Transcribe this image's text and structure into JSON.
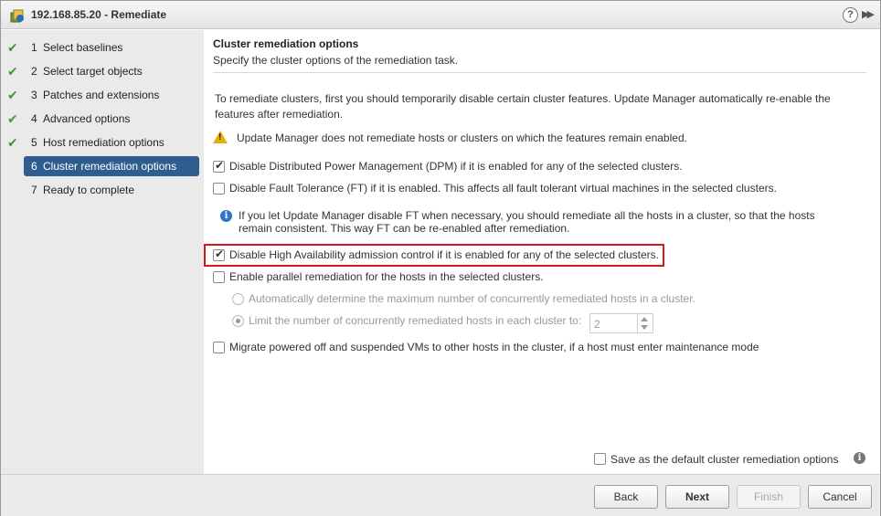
{
  "window": {
    "title": "192.168.85.20 - Remediate",
    "help_label": "?",
    "expand_label": "▶▶"
  },
  "steps": [
    {
      "num": "1",
      "label": "Select baselines",
      "done": true
    },
    {
      "num": "2",
      "label": "Select target objects",
      "done": true
    },
    {
      "num": "3",
      "label": "Patches and extensions",
      "done": true
    },
    {
      "num": "4",
      "label": "Advanced options",
      "done": true
    },
    {
      "num": "5",
      "label": "Host remediation options",
      "done": true
    },
    {
      "num": "6",
      "label": "Cluster remediation options",
      "done": false,
      "active": true
    },
    {
      "num": "7",
      "label": "Ready to complete",
      "done": false
    }
  ],
  "check_glyph": "✔",
  "header": {
    "title": "Cluster remediation options",
    "subtitle": "Specify the cluster options of the remediation task."
  },
  "intro": {
    "line1": "To remediate clusters, first you should temporarily disable certain cluster features. Update Manager automatically re-enable the",
    "line2": "features after remediation."
  },
  "warning": "Update Manager does not remediate hosts or clusters on which the features remain enabled.",
  "options": {
    "dpm": {
      "label": "Disable Distributed Power Management (DPM) if it is enabled for any of the selected clusters.",
      "checked": true
    },
    "ft": {
      "label": "Disable Fault Tolerance (FT) if it is enabled. This affects all fault tolerant virtual machines in the selected clusters.",
      "checked": false
    },
    "ft_info_line1": "If you let Update Manager disable FT when necessary, you should remediate all the hosts in a cluster, so that the hosts",
    "ft_info_line2": "remain consistent. This way FT can be re-enabled after remediation.",
    "ha": {
      "label": "Disable High Availability admission control if it is enabled for any of the selected clusters.",
      "checked": true
    },
    "parallel": {
      "label": "Enable parallel remediation for the hosts in the selected clusters.",
      "checked": false
    },
    "auto_radio": {
      "label": "Automatically determine the maximum number of concurrently remediated hosts in a cluster.",
      "selected": false
    },
    "limit_radio": {
      "label": "Limit the number of concurrently remediated hosts in each cluster to:",
      "selected": true
    },
    "limit_value": "2",
    "migrate": {
      "label": "Migrate powered off and suspended VMs to other hosts in the cluster, if a host must enter maintenance mode",
      "checked": false
    },
    "save_default": {
      "label": "Save as the default cluster remediation options",
      "checked": false
    }
  },
  "info_glyph": "i",
  "buttons": {
    "back": "Back",
    "next": "Next",
    "finish": "Finish",
    "cancel": "Cancel"
  },
  "colors": {
    "active_step": "#2f5d8e",
    "check": "#3d9d2f",
    "highlight": "#d9141c",
    "warning": "#e6b000",
    "info": "#2d77c6"
  }
}
